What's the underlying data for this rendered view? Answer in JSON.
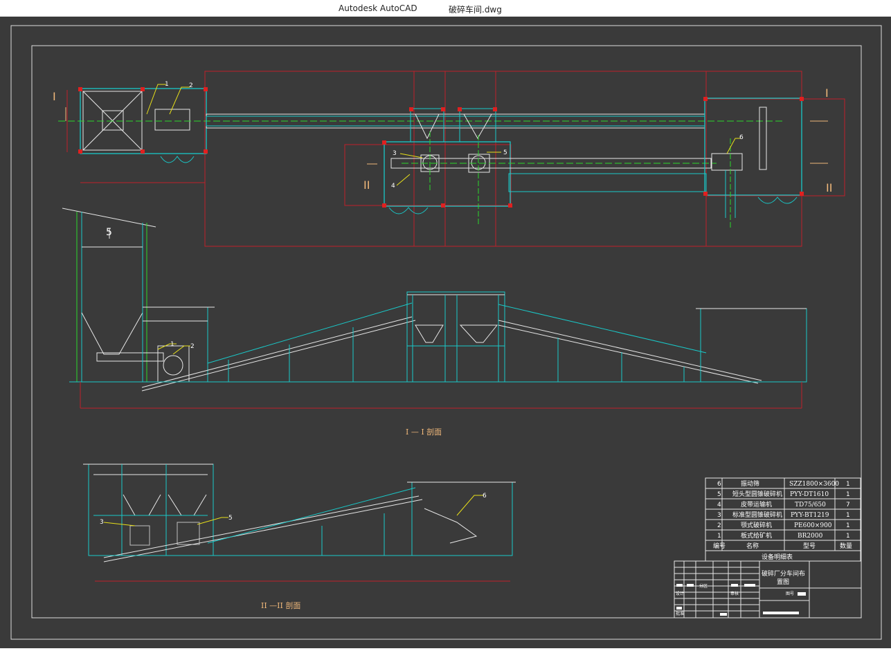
{
  "window": {
    "app_name": "Autodesk AutoCAD",
    "file_name": "破碎车间.dwg"
  },
  "plan": {
    "section_marks": [
      "I",
      "I",
      "II",
      "II"
    ],
    "callouts": [
      "1",
      "2",
      "3",
      "4",
      "5",
      "6"
    ]
  },
  "section_1": {
    "label": "I — I 剖面",
    "callouts": [
      "1",
      "2"
    ],
    "hook_label": "5"
  },
  "section_2": {
    "label": "II —II 剖面",
    "callouts": [
      "3",
      "5",
      "6"
    ]
  },
  "equipment_table": {
    "title": "设备明细表",
    "headers": [
      "编号",
      "名称",
      "型号",
      "数量"
    ],
    "rows": [
      [
        "6",
        "振动筛",
        "SZZ1800×3600",
        "1"
      ],
      [
        "5",
        "短头型圆锥破碎机",
        "PYY-DT1610",
        "1"
      ],
      [
        "4",
        "皮带运输机",
        "TD75/650",
        "7"
      ],
      [
        "3",
        "标准型圆锥破碎机",
        "PYY-BT1219",
        "1"
      ],
      [
        "2",
        "颚式破碎机",
        "PE600×900",
        "1"
      ],
      [
        "1",
        "板式给矿机",
        "BR2000",
        "1"
      ]
    ]
  },
  "title_block": {
    "drawing_title_line1": "破碎厂分车间布",
    "drawing_title_line2": "置图",
    "small_labels": [
      "分区",
      "设计",
      "审核",
      "批准",
      "图号"
    ]
  }
}
